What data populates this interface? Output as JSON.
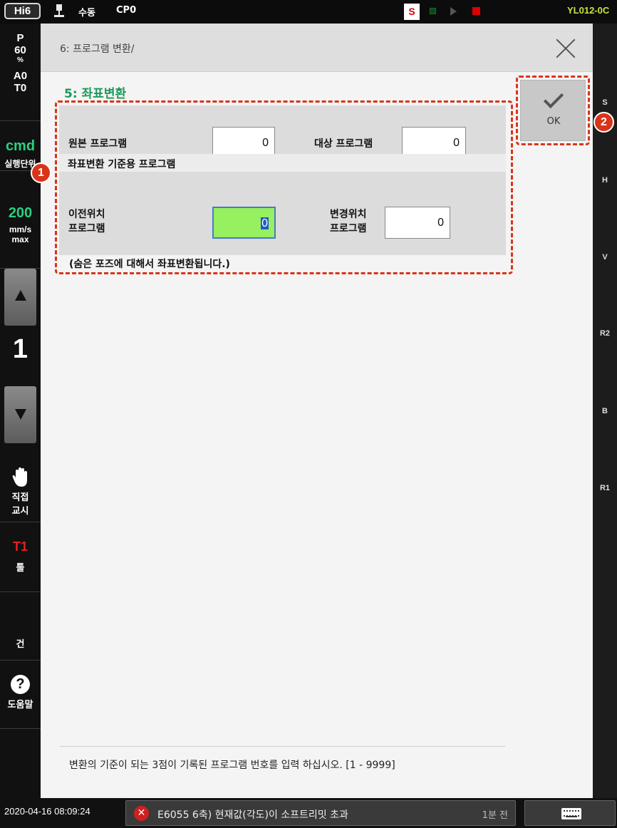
{
  "topbar": {
    "logo": "Hi6",
    "mode": "수동",
    "program": "CP0",
    "servo_badge": "S",
    "robot_name": "YL012-0C"
  },
  "left_sidebar": {
    "speed": {
      "label_p": "P",
      "value": "60",
      "unit": "%"
    },
    "ao": "A0",
    "to": "T0",
    "cmd": {
      "value": "cmd",
      "label": "실행단위"
    },
    "velocity": {
      "value": "200",
      "unit": "mm/s",
      "mode": "max"
    },
    "step": "1",
    "direct_teach": {
      "line1": "직접",
      "line2": "교시"
    },
    "coord": {
      "value": "T1",
      "label": "툴"
    },
    "blank_label": "건",
    "help_label": "도움말"
  },
  "right_sidebar": {
    "labels": [
      "S",
      "H",
      "V",
      "R2",
      "B",
      "R1"
    ]
  },
  "dialog": {
    "breadcrumb": "6: 프로그램 변환/",
    "section_title": "5: 좌표변환",
    "source_program_label": "원본 프로그램",
    "source_program_value": "0",
    "target_program_label": "대상 프로그램",
    "target_program_value": "0",
    "reference_heading": "좌표변환 기준용 프로그램",
    "prev_pos_label_1": "이전위치",
    "prev_pos_label_2": "프로그램",
    "prev_pos_value": "0",
    "new_pos_label_1": "변경위치",
    "new_pos_label_2": "프로그램",
    "new_pos_value": "0",
    "note": "(숨은 포즈에 대해서 좌표변환됩니다.)",
    "ok_label": "OK",
    "hint": "변환의 기준이 되는 3점이 기록된 프로그램 번호를 입력 하십시오. [1 - 9999]"
  },
  "markers": [
    "1",
    "2"
  ],
  "bottombar": {
    "datetime": "2020-04-16 08:09:24",
    "alarm_text": "E6055 6축) 현재값(각도)이 소프트리밋 초과",
    "alarm_time": "1분 전"
  },
  "colors": {
    "section_title": "#1a9a5a",
    "highlight": "#d9341a",
    "active_field": "#96f060",
    "speed_value": "#28d080",
    "coord_value": "#e82020",
    "robot_name": "#c8e640"
  }
}
